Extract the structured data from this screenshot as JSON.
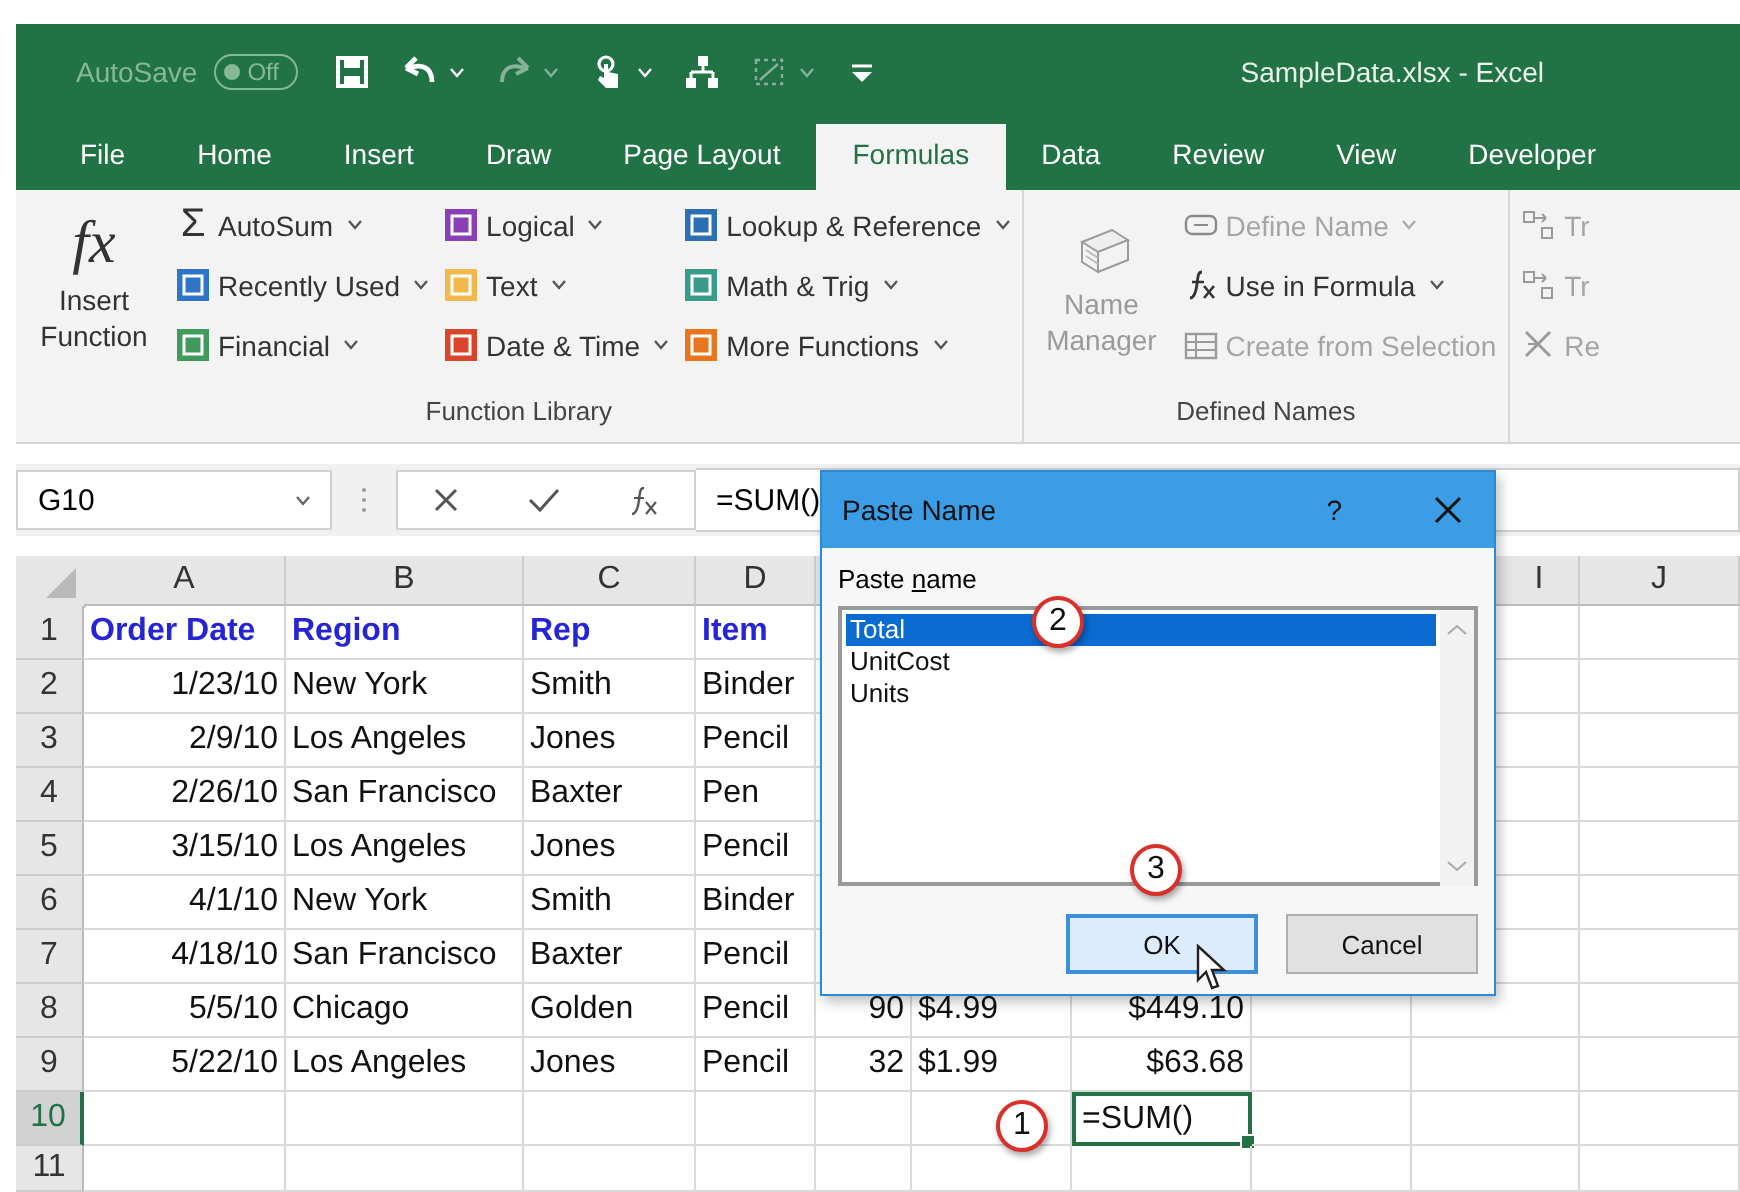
{
  "title_bar": {
    "autosave": {
      "label": "AutoSave",
      "toggle_text": "Off",
      "on": false
    },
    "quick_access": [
      {
        "kind": "save",
        "disabled": false,
        "dropdown": false
      },
      {
        "kind": "undo",
        "disabled": false,
        "dropdown": true
      },
      {
        "kind": "redo",
        "disabled": true,
        "dropdown": true
      },
      {
        "kind": "touch",
        "disabled": false,
        "dropdown": true
      },
      {
        "kind": "tree",
        "disabled": false,
        "dropdown": false
      },
      {
        "kind": "shape",
        "disabled": true,
        "dropdown": true
      },
      {
        "kind": "customize",
        "disabled": false,
        "dropdown": false
      }
    ],
    "document_title": "SampleData.xlsx - Excel"
  },
  "tabs": [
    {
      "label": "File",
      "selected": false
    },
    {
      "label": "Home",
      "selected": false
    },
    {
      "label": "Insert",
      "selected": false
    },
    {
      "label": "Draw",
      "selected": false
    },
    {
      "label": "Page Layout",
      "selected": false
    },
    {
      "label": "Formulas",
      "selected": true
    },
    {
      "label": "Data",
      "selected": false
    },
    {
      "label": "Review",
      "selected": false
    },
    {
      "label": "View",
      "selected": false
    },
    {
      "label": "Developer",
      "selected": false
    }
  ],
  "ribbon": [
    {
      "label": "Function Library",
      "large_button": {
        "glyph": "fx",
        "label": "Insert Function",
        "disabled": false
      },
      "columns": [
        [
          {
            "kind": "glyph",
            "glyph": "Σ",
            "label": "AutoSum",
            "dropdown": true,
            "disabled": false
          },
          {
            "kind": "tile",
            "color": "#2e75c7",
            "label": "Recently Used",
            "dropdown": true,
            "disabled": false
          },
          {
            "kind": "tile",
            "color": "#3f9a5c",
            "label": "Financial",
            "dropdown": true,
            "disabled": false
          }
        ],
        [
          {
            "kind": "tile",
            "color": "#8a3fb5",
            "label": "Logical",
            "dropdown": true,
            "disabled": false
          },
          {
            "kind": "tile",
            "color": "#f2b84b",
            "label": "Text",
            "dropdown": true,
            "disabled": false
          },
          {
            "kind": "tile",
            "color": "#d9452b",
            "label": "Date & Time",
            "dropdown": true,
            "disabled": false
          }
        ],
        [
          {
            "kind": "tile",
            "color": "#2c6fb3",
            "label": "Lookup & Reference",
            "dropdown": true,
            "disabled": false
          },
          {
            "kind": "tile",
            "color": "#3a9a8a",
            "label": "Math & Trig",
            "dropdown": true,
            "disabled": false
          },
          {
            "kind": "tile",
            "color": "#e8761f",
            "label": "More Functions",
            "dropdown": true,
            "disabled": false
          }
        ]
      ]
    },
    {
      "label": "Defined Names",
      "large_button": {
        "label": "Name Manager",
        "disabled": true
      },
      "columns": [
        [
          {
            "kind": "tag",
            "label": "Define Name",
            "dropdown": true,
            "disabled": true
          },
          {
            "kind": "fx",
            "label": "Use in Formula",
            "dropdown": true,
            "disabled": false
          },
          {
            "kind": "table",
            "label": "Create from Selection",
            "dropdown": false,
            "disabled": true
          }
        ]
      ]
    },
    {
      "columns": [
        [
          {
            "kind": "trace",
            "label": "Tr",
            "dropdown": false,
            "disabled": true
          },
          {
            "kind": "trace",
            "label": "Tr",
            "dropdown": false,
            "disabled": true
          },
          {
            "kind": "remove",
            "label": "Re",
            "dropdown": false,
            "disabled": true
          }
        ]
      ]
    }
  ],
  "formula_bar": {
    "name_box": "G10",
    "formula": "=SUM()"
  },
  "sheet": {
    "column_headers": {
      "A": {
        "label": "A",
        "selected": false
      },
      "B": {
        "label": "B",
        "selected": false
      },
      "C": {
        "label": "C",
        "selected": false
      },
      "D": {
        "label": "D",
        "selected": false
      },
      "I": {
        "label": "I",
        "selected": false
      },
      "J": {
        "label": "J",
        "selected": false
      }
    },
    "rows": [
      {
        "number": "1",
        "selected": false,
        "cells": {
          "A": {
            "kind": "header",
            "text": "Order Date",
            "selected": false
          },
          "B": {
            "kind": "header",
            "text": "Region",
            "selected": false
          },
          "C": {
            "kind": "header",
            "text": "Rep",
            "selected": false
          },
          "D": {
            "kind": "header",
            "text": "Item",
            "selected": false
          }
        }
      },
      {
        "number": "2",
        "selected": false,
        "cells": {
          "A": {
            "kind": "number",
            "text": "1/23/10",
            "selected": false
          },
          "B": {
            "kind": "text",
            "text": "New York",
            "selected": false
          },
          "C": {
            "kind": "text",
            "text": "Smith",
            "selected": false
          },
          "D": {
            "kind": "text",
            "text": "Binder",
            "selected": false
          }
        }
      },
      {
        "number": "3",
        "selected": false,
        "cells": {
          "A": {
            "kind": "number",
            "text": "2/9/10",
            "selected": false
          },
          "B": {
            "kind": "text",
            "text": "Los Angeles",
            "selected": false
          },
          "C": {
            "kind": "text",
            "text": "Jones",
            "selected": false
          },
          "D": {
            "kind": "text",
            "text": "Pencil",
            "selected": false
          }
        }
      },
      {
        "number": "4",
        "selected": false,
        "cells": {
          "A": {
            "kind": "number",
            "text": "2/26/10",
            "selected": false
          },
          "B": {
            "kind": "text",
            "text": "San Francisco",
            "selected": false
          },
          "C": {
            "kind": "text",
            "text": "Baxter",
            "selected": false
          },
          "D": {
            "kind": "text",
            "text": "Pen",
            "selected": false
          }
        }
      },
      {
        "number": "5",
        "selected": false,
        "cells": {
          "A": {
            "kind": "number",
            "text": "3/15/10",
            "selected": false
          },
          "B": {
            "kind": "text",
            "text": "Los Angeles",
            "selected": false
          },
          "C": {
            "kind": "text",
            "text": "Jones",
            "selected": false
          },
          "D": {
            "kind": "text",
            "text": "Pencil",
            "selected": false
          }
        }
      },
      {
        "number": "6",
        "selected": false,
        "cells": {
          "A": {
            "kind": "number",
            "text": "4/1/10",
            "selected": false
          },
          "B": {
            "kind": "text",
            "text": "New York",
            "selected": false
          },
          "C": {
            "kind": "text",
            "text": "Smith",
            "selected": false
          },
          "D": {
            "kind": "text",
            "text": "Binder",
            "selected": false
          }
        }
      },
      {
        "number": "7",
        "selected": false,
        "cells": {
          "A": {
            "kind": "number",
            "text": "4/18/10",
            "selected": false
          },
          "B": {
            "kind": "text",
            "text": "San Francisco",
            "selected": false
          },
          "C": {
            "kind": "text",
            "text": "Baxter",
            "selected": false
          },
          "D": {
            "kind": "text",
            "text": "Pencil",
            "selected": false
          }
        }
      },
      {
        "number": "8",
        "selected": false,
        "cells": {
          "A": {
            "kind": "number",
            "text": "5/5/10",
            "selected": false
          },
          "B": {
            "kind": "text",
            "text": "Chicago",
            "selected": false
          },
          "C": {
            "kind": "text",
            "text": "Golden",
            "selected": false
          },
          "D": {
            "kind": "text",
            "text": "Pencil",
            "selected": false
          },
          "E": {
            "kind": "number",
            "text": "90",
            "selected": false
          },
          "F": {
            "kind": "text",
            "text": "$4.99",
            "selected": false
          },
          "G": {
            "kind": "number",
            "text": "$449.10",
            "selected": false
          }
        }
      },
      {
        "number": "9",
        "selected": false,
        "cells": {
          "A": {
            "kind": "number",
            "text": "5/22/10",
            "selected": false
          },
          "B": {
            "kind": "text",
            "text": "Los Angeles",
            "selected": false
          },
          "C": {
            "kind": "text",
            "text": "Jones",
            "selected": false
          },
          "D": {
            "kind": "text",
            "text": "Pencil",
            "selected": false
          },
          "E": {
            "kind": "number",
            "text": "32",
            "selected": false
          },
          "F": {
            "kind": "text",
            "text": "$1.99",
            "selected": false
          },
          "G": {
            "kind": "number",
            "text": "$63.68",
            "selected": false
          }
        }
      },
      {
        "number": "10",
        "selected": true,
        "cells": {
          "G": {
            "kind": "text",
            "text": "=SUM()",
            "selected": true
          }
        }
      },
      {
        "number": "11",
        "selected": false
      }
    ]
  },
  "dialog": {
    "title": "Paste Name",
    "help": "?",
    "list_label": {
      "before": "Paste ",
      "access_key": "n",
      "after": "ame"
    },
    "items": [
      {
        "label": "Total",
        "selected": true
      },
      {
        "label": "UnitCost",
        "selected": false
      },
      {
        "label": "Units",
        "selected": false
      }
    ],
    "buttons": [
      {
        "label": "OK",
        "default": true
      },
      {
        "label": "Cancel",
        "default": false
      }
    ]
  },
  "callouts": [
    {
      "label": "2",
      "kind": "list"
    },
    {
      "label": "3",
      "kind": "ok"
    },
    {
      "label": "1",
      "kind": "cell"
    }
  ]
}
